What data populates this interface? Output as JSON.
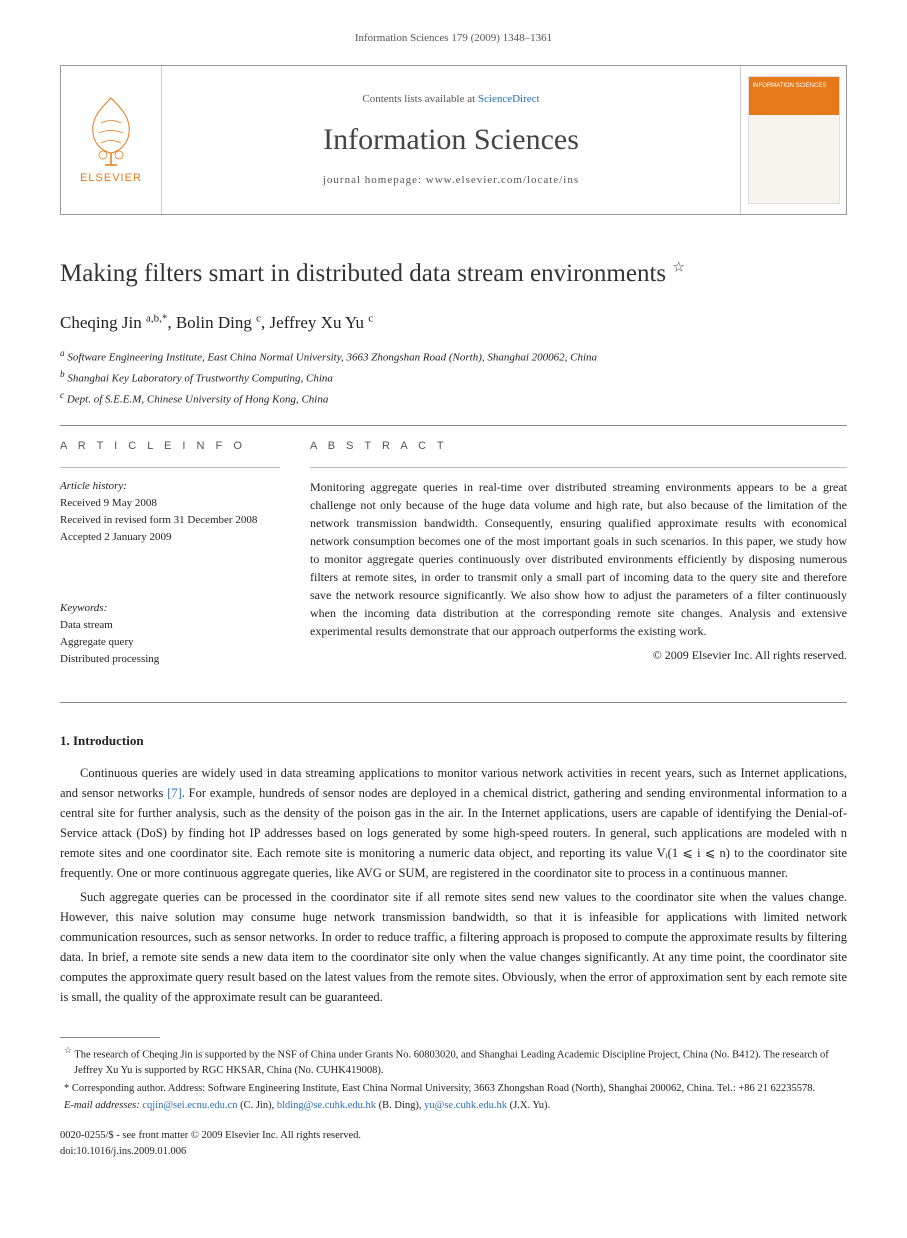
{
  "header_line": "Information Sciences 179 (2009) 1348–1361",
  "journal_box": {
    "elsevier_label": "ELSEVIER",
    "contents_prefix": "Contents lists available at ",
    "contents_link": "ScienceDirect",
    "journal_name": "Information Sciences",
    "homepage_label": "journal homepage: www.elsevier.com/locate/ins",
    "cover_title": "INFORMATION SCIENCES"
  },
  "title": "Making filters smart in distributed data stream environments",
  "title_star": "☆",
  "authors_html": "Cheqing Jin <sup>a,b,*</sup>, Bolin Ding <sup>c</sup>, Jeffrey Xu Yu <sup>c</sup>",
  "affiliations": {
    "a": "Software Engineering Institute, East China Normal University, 3663 Zhongshan Road (North), Shanghai 200062, China",
    "b": "Shanghai Key Laboratory of Trustworthy Computing, China",
    "c": "Dept. of S.E.E.M, Chinese University of Hong Kong, China"
  },
  "info_heading": "A R T I C L E   I N F O",
  "abstract_heading": "A B S T R A C T",
  "article_history_label": "Article history:",
  "article_history": {
    "received": "Received 9 May 2008",
    "revised": "Received in revised form 31 December 2008",
    "accepted": "Accepted 2 January 2009"
  },
  "keywords_label": "Keywords:",
  "keywords": {
    "k1": "Data stream",
    "k2": "Aggregate query",
    "k3": "Distributed processing"
  },
  "abstract_text": "Monitoring aggregate queries in real-time over distributed streaming environments appears to be a great challenge not only because of the huge data volume and high rate, but also because of the limitation of the network transmission bandwidth. Consequently, ensuring qualified approximate results with economical network consumption becomes one of the most important goals in such scenarios. In this paper, we study how to monitor aggregate queries continuously over distributed environments efficiently by disposing numerous filters at remote sites, in order to transmit only a small part of incoming data to the query site and therefore save the network resource significantly. We also show how to adjust the parameters of a filter continuously when the incoming data distribution at the corresponding remote site changes. Analysis and extensive experimental results demonstrate that our approach outperforms the existing work.",
  "copyright": "© 2009 Elsevier Inc. All rights reserved.",
  "section1_heading": "1. Introduction",
  "para1_before_ref": "Continuous queries are widely used in data streaming applications to monitor various network activities in recent years, such as Internet applications, and sensor networks ",
  "para1_ref": "[7]",
  "para1_after_ref": ". For example, hundreds of sensor nodes are deployed in a chemical district, gathering and sending environmental information to a central site for further analysis, such as the density of the poison gas in the air. In the Internet applications, users are capable of identifying the Denial-of-Service attack (DoS) by finding hot IP addresses based on logs generated by some high-speed routers. In general, such applications are modeled with n remote sites and one coordinator site. Each remote site is monitoring a numeric data object, and reporting its value Vᵢ(1 ⩽ i ⩽ n) to the coordinator site frequently. One or more continuous aggregate queries, like AVG or SUM, are registered in the coordinator site to process in a continuous manner.",
  "para2": "Such aggregate queries can be processed in the coordinator site if all remote sites send new values to the coordinator site when the values change. However, this naive solution may consume huge network transmission bandwidth, so that it is infeasible for applications with limited network communication resources, such as sensor networks. In order to reduce traffic, a filtering approach is proposed to compute the approximate results by filtering data. In brief, a remote site sends a new data item to the coordinator site only when the value changes significantly. At any time point, the coordinator site computes the approximate query result based on the latest values from the remote sites. Obviously, when the error of approximation sent by each remote site is small, the quality of the approximate result can be guaranteed.",
  "footnotes": {
    "star": "The research of Cheqing Jin is supported by the NSF of China under Grants No. 60803020, and Shanghai Leading Academic Discipline Project, China (No. B412). The research of Jeffrey Xu Yu is supported by RGC HKSAR, China (No. CUHK419008).",
    "corr_label": "* Corresponding author. Address: Software Engineering Institute, East China Normal University, 3663 Zhongshan Road (North), Shanghai 200062, China. Tel.: +86 21 62235578.",
    "email_label": "E-mail addresses: ",
    "email1": "cqjin@sei.ecnu.edu.cn",
    "email1_who": " (C. Jin), ",
    "email2": "blding@se.cuhk.edu.hk",
    "email2_who": " (B. Ding), ",
    "email3": "yu@se.cuhk.edu.hk",
    "email3_who": " (J.X. Yu)."
  },
  "bottom": {
    "line1": "0020-0255/$ - see front matter © 2009 Elsevier Inc. All rights reserved.",
    "line2": "doi:10.1016/j.ins.2009.01.006"
  }
}
